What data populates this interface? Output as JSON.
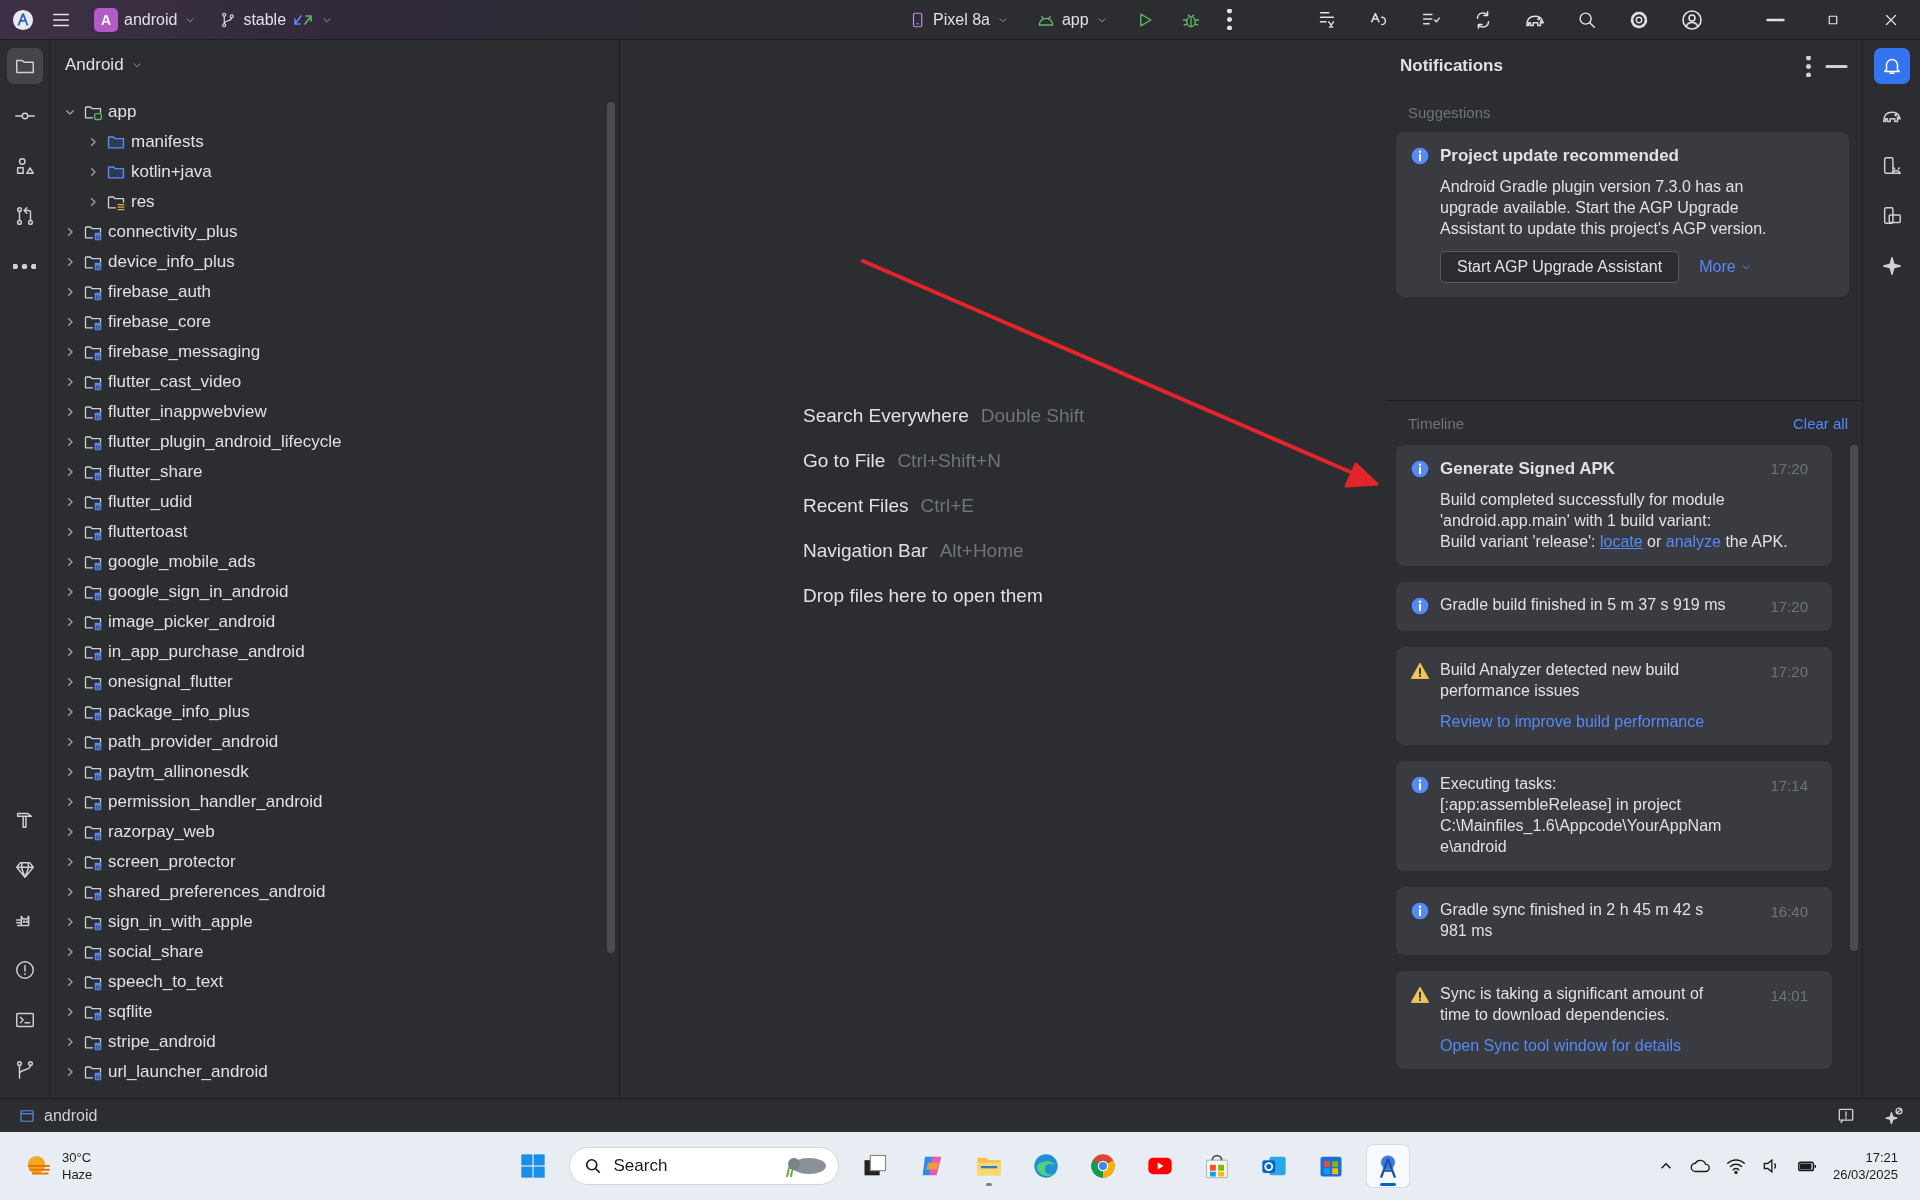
{
  "title_bar": {
    "project_badge": "A",
    "project": "android",
    "branch": "stable",
    "device": "Pixel 8a",
    "run_config": "app"
  },
  "left_toolbar": {
    "top": [
      {
        "kind": "folder",
        "selected": true
      },
      {
        "kind": "commit",
        "selected": false
      },
      {
        "kind": "shapes",
        "selected": false
      },
      {
        "kind": "pull_request",
        "selected": false
      },
      {
        "kind": "more",
        "selected": false
      }
    ],
    "bottom": [
      {
        "kind": "hammer",
        "selected": false
      },
      {
        "kind": "gem",
        "selected": false
      },
      {
        "kind": "cat",
        "selected": false
      },
      {
        "kind": "problems",
        "selected": false
      },
      {
        "kind": "terminal",
        "selected": false
      },
      {
        "kind": "vcs",
        "selected": false
      }
    ]
  },
  "project_panel": {
    "view": "Android",
    "tree": [
      {
        "label": "app",
        "kind": "app",
        "expanded": true,
        "children": [
          {
            "label": "manifests",
            "kind": "folder",
            "expanded": false
          },
          {
            "label": "kotlin+java",
            "kind": "folder",
            "expanded": false
          },
          {
            "label": "res",
            "kind": "res",
            "expanded": false
          }
        ]
      },
      {
        "label": "connectivity_plus",
        "kind": "module",
        "expanded": false
      },
      {
        "label": "device_info_plus",
        "kind": "module",
        "expanded": false
      },
      {
        "label": "firebase_auth",
        "kind": "module",
        "expanded": false
      },
      {
        "label": "firebase_core",
        "kind": "module",
        "expanded": false
      },
      {
        "label": "firebase_messaging",
        "kind": "module",
        "expanded": false
      },
      {
        "label": "flutter_cast_video",
        "kind": "module",
        "expanded": false
      },
      {
        "label": "flutter_inappwebview",
        "kind": "module",
        "expanded": false
      },
      {
        "label": "flutter_plugin_android_lifecycle",
        "kind": "module",
        "expanded": false
      },
      {
        "label": "flutter_share",
        "kind": "module",
        "expanded": false
      },
      {
        "label": "flutter_udid",
        "kind": "module",
        "expanded": false
      },
      {
        "label": "fluttertoast",
        "kind": "module",
        "expanded": false
      },
      {
        "label": "google_mobile_ads",
        "kind": "module",
        "expanded": false
      },
      {
        "label": "google_sign_in_android",
        "kind": "module",
        "expanded": false
      },
      {
        "label": "image_picker_android",
        "kind": "module",
        "expanded": false
      },
      {
        "label": "in_app_purchase_android",
        "kind": "module",
        "expanded": false
      },
      {
        "label": "onesignal_flutter",
        "kind": "module",
        "expanded": false
      },
      {
        "label": "package_info_plus",
        "kind": "module",
        "expanded": false
      },
      {
        "label": "path_provider_android",
        "kind": "module",
        "expanded": false
      },
      {
        "label": "paytm_allinonesdk",
        "kind": "module",
        "expanded": false
      },
      {
        "label": "permission_handler_android",
        "kind": "module",
        "expanded": false
      },
      {
        "label": "razorpay_web",
        "kind": "module",
        "expanded": false
      },
      {
        "label": "screen_protector",
        "kind": "module",
        "expanded": false
      },
      {
        "label": "shared_preferences_android",
        "kind": "module",
        "expanded": false
      },
      {
        "label": "sign_in_with_apple",
        "kind": "module",
        "expanded": false
      },
      {
        "label": "social_share",
        "kind": "module",
        "expanded": false
      },
      {
        "label": "speech_to_text",
        "kind": "module",
        "expanded": false
      },
      {
        "label": "sqflite",
        "kind": "module",
        "expanded": false
      },
      {
        "label": "stripe_android",
        "kind": "module",
        "expanded": false
      },
      {
        "label": "url_launcher_android",
        "kind": "module",
        "expanded": false
      }
    ]
  },
  "editor": {
    "hints": [
      {
        "action": "Search Everywhere",
        "shortcut": "Double Shift"
      },
      {
        "action": "Go to File",
        "shortcut": "Ctrl+Shift+N"
      },
      {
        "action": "Recent Files",
        "shortcut": "Ctrl+E"
      },
      {
        "action": "Navigation Bar",
        "shortcut": "Alt+Home"
      },
      {
        "action": "Drop files here to open them"
      }
    ]
  },
  "notifications": {
    "title": "Notifications",
    "suggestions_label": "Suggestions",
    "suggestion": {
      "kind": "info",
      "title": "Project update recommended",
      "body": "Android Gradle plugin version 7.3.0 has an upgrade available. Start the AGP Upgrade Assistant to update this project's AGP version.",
      "button": "Start AGP Upgrade Assistant",
      "more": "More"
    },
    "timeline_label": "Timeline",
    "clear_all": "Clear all",
    "timeline": [
      {
        "kind": "info",
        "title": "Generate Signed APK",
        "time": "17:20",
        "body": "Build completed successfully for module 'android.app.main' with 1 build variant:",
        "parts": [
          {
            "text": "Build variant 'release': "
          },
          {
            "text": "locate",
            "link": true,
            "underlined": true
          },
          {
            "text": " or "
          },
          {
            "text": "analyze",
            "link": true,
            "underlined": false
          },
          {
            "text": " the APK."
          }
        ]
      },
      {
        "kind": "info",
        "message": "Gradle build finished in 5 m 37 s 919 ms",
        "time": "17:20"
      },
      {
        "kind": "warning",
        "message": "Build Analyzer detected new build performance issues",
        "time": "17:20",
        "action": "Review to improve build performance"
      },
      {
        "kind": "info",
        "message": "Executing tasks: [:app:assembleRelease] in project C:\\Mainfiles_1.6\\Appcode\\YourAppName\\android",
        "time": "17:14"
      },
      {
        "kind": "info",
        "message": "Gradle sync finished in 2 h 45 m 42 s 981 ms",
        "time": "16:40"
      },
      {
        "kind": "warning",
        "message": "Sync is taking a significant amount of time to download dependencies.",
        "time": "14:01",
        "action": "Open Sync tool window for details"
      }
    ]
  },
  "right_toolbar": [
    {
      "kind": "bell",
      "selected": true
    },
    {
      "kind": "elephant",
      "selected": false
    },
    {
      "kind": "device",
      "selected": false
    },
    {
      "kind": "mirror",
      "selected": false
    },
    {
      "kind": "sparkle",
      "selected": false
    }
  ],
  "status_bar": {
    "project": "android"
  },
  "taskbar": {
    "temperature": "30°C",
    "condition": "Haze",
    "search_placeholder": "Search",
    "apps": [
      {
        "kind": "task_view",
        "selected": false,
        "running": false
      },
      {
        "kind": "copilot",
        "selected": false,
        "running": false
      },
      {
        "kind": "files",
        "selected": false,
        "running": true
      },
      {
        "kind": "edge",
        "selected": false,
        "running": false
      },
      {
        "kind": "chrome",
        "selected": false,
        "running": false
      },
      {
        "kind": "youtube",
        "selected": false,
        "running": false
      },
      {
        "kind": "bag",
        "selected": false,
        "running": false
      },
      {
        "kind": "outlook",
        "selected": false,
        "running": false
      },
      {
        "kind": "store",
        "selected": false,
        "running": false
      },
      {
        "kind": "studio",
        "selected": true,
        "running": true
      }
    ],
    "time": "17:21",
    "date": "26/03/2025"
  }
}
